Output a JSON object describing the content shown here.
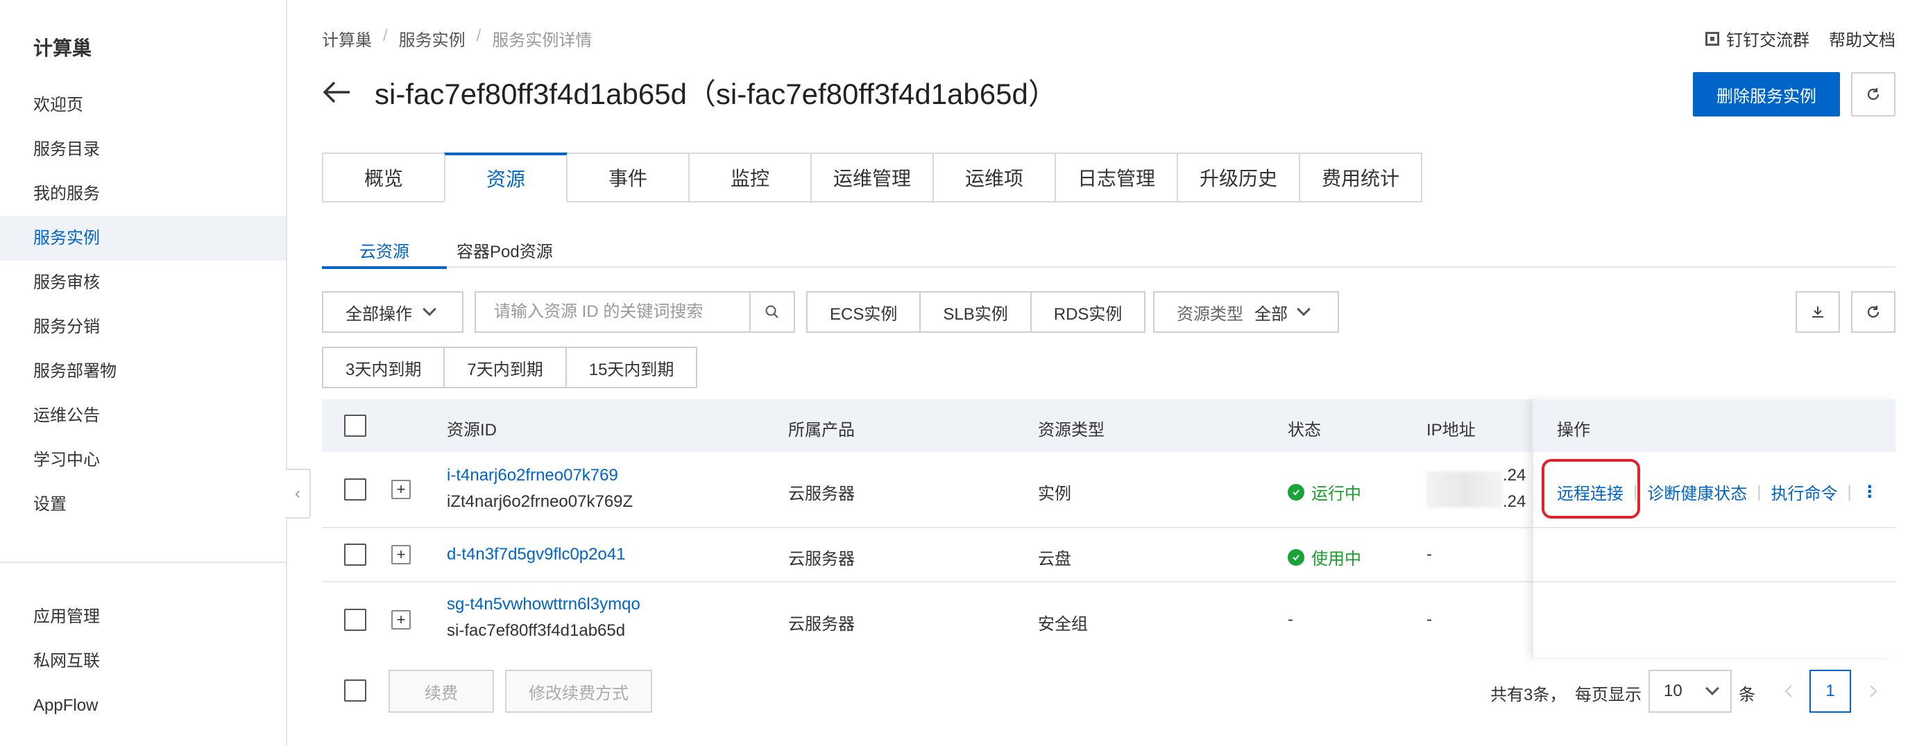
{
  "sidebar": {
    "brand": "计算巢",
    "items": [
      {
        "label": "欢迎页"
      },
      {
        "label": "服务目录"
      },
      {
        "label": "我的服务"
      },
      {
        "label": "服务实例"
      },
      {
        "label": "服务审核"
      },
      {
        "label": "服务分销"
      },
      {
        "label": "服务部署物"
      },
      {
        "label": "运维公告"
      },
      {
        "label": "学习中心"
      },
      {
        "label": "设置"
      }
    ],
    "active_index": 3,
    "bottom_items": [
      {
        "label": "应用管理"
      },
      {
        "label": "私网互联"
      },
      {
        "label": "AppFlow"
      }
    ]
  },
  "breadcrumb": [
    "计算巢",
    "服务实例",
    "服务实例详情"
  ],
  "top_links": {
    "dingtalk": "钉钉交流群",
    "help": "帮助文档"
  },
  "page": {
    "title": "si-fac7ef80ff3f4d1ab65d（si-fac7ef80ff3f4d1ab65d）",
    "delete_button": "删除服务实例"
  },
  "main_tabs": [
    "概览",
    "资源",
    "事件",
    "监控",
    "运维管理",
    "运维项",
    "日志管理",
    "升级历史",
    "费用统计"
  ],
  "main_tab_active": 1,
  "sub_tabs": [
    "云资源",
    "容器Pod资源"
  ],
  "toolbar": {
    "all_ops": "全部操作",
    "search_placeholder": "请输入资源 ID 的关键词搜索",
    "filters": [
      "ECS实例",
      "SLB实例",
      "RDS实例"
    ],
    "res_type_label": "资源类型",
    "res_type_value": "全部",
    "expire_filters": [
      "3天内到期",
      "7天内到期",
      "15天内到期"
    ]
  },
  "table": {
    "headers": {
      "id": "资源ID",
      "product": "所属产品",
      "type": "资源类型",
      "status": "状态",
      "ip": "IP地址",
      "ops": "操作"
    },
    "rows": [
      {
        "id": "i-t4narj6o2frneo07k769",
        "sub": "iZt4narj6o2frneo07k769Z",
        "product": "云服务器",
        "type": "实例",
        "status": "运行中",
        "ip_suffix_1": ".24",
        "ip_suffix_2": ".24"
      },
      {
        "id": "d-t4n3f7d5gv9flc0p2o41",
        "sub": "",
        "product": "云服务器",
        "type": "云盘",
        "status": "使用中",
        "ip": "-"
      },
      {
        "id": "sg-t4n5vwhowttrn6l3ymqo",
        "sub": "si-fac7ef80ff3f4d1ab65d",
        "product": "云服务器",
        "type": "安全组",
        "status": "-",
        "ip": "-"
      }
    ],
    "ops": [
      "远程连接",
      "诊断健康状态",
      "执行命令"
    ],
    "more": "⋮"
  },
  "footer": {
    "renew": "续费",
    "change_renew": "修改续费方式",
    "total": "共有3条，",
    "per_page_label": "每页显示",
    "per_page": "10",
    "unit": "条",
    "current_page": "1"
  },
  "colors": {
    "accent": "#0064c8",
    "success": "#1aa338",
    "highlight": "#e0232f"
  }
}
